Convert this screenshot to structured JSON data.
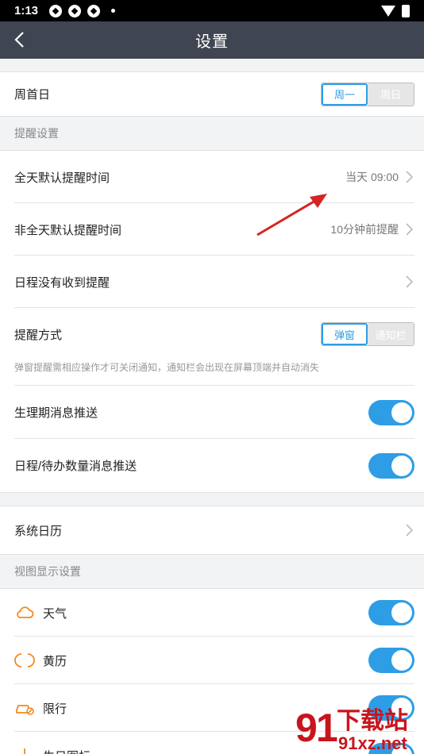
{
  "status": {
    "time": "1:13"
  },
  "nav": {
    "title": "设置"
  },
  "week": {
    "label": "周首日",
    "opt_on": "周一",
    "opt_off": "周日"
  },
  "remind_section": {
    "title": "提醒设置"
  },
  "allday": {
    "label": "全天默认提醒时间",
    "value": "当天 09:00"
  },
  "nonallday": {
    "label": "非全天默认提醒时间",
    "value": "10分钟前提醒"
  },
  "no_remind": {
    "label": "日程没有收到提醒"
  },
  "method": {
    "label": "提醒方式",
    "opt_on": "弹窗",
    "opt_off": "通知栏",
    "hint": "弹窗提醒需相应操作才可关闭通知，通知栏会出现在屏幕顶端并自动消失"
  },
  "period": {
    "label": "生理期消息推送",
    "on": true
  },
  "todo": {
    "label": "日程/待办数量消息推送",
    "on": true
  },
  "syscal": {
    "label": "系统日历"
  },
  "view_section": {
    "title": "视图显示设置"
  },
  "view_items": [
    {
      "label": "天气",
      "icon": "cloud-icon"
    },
    {
      "label": "黄历",
      "icon": "almanac-icon"
    },
    {
      "label": "限行",
      "icon": "car-restriction-icon"
    },
    {
      "label": "生日图标",
      "icon": "birthday-icon"
    }
  ],
  "watermark": {
    "brand": "下载站",
    "domain": "91xz.net"
  },
  "colors": {
    "accent": "#2d9de6",
    "icon_orange": "#f08a24",
    "nav_bg": "#404651"
  }
}
